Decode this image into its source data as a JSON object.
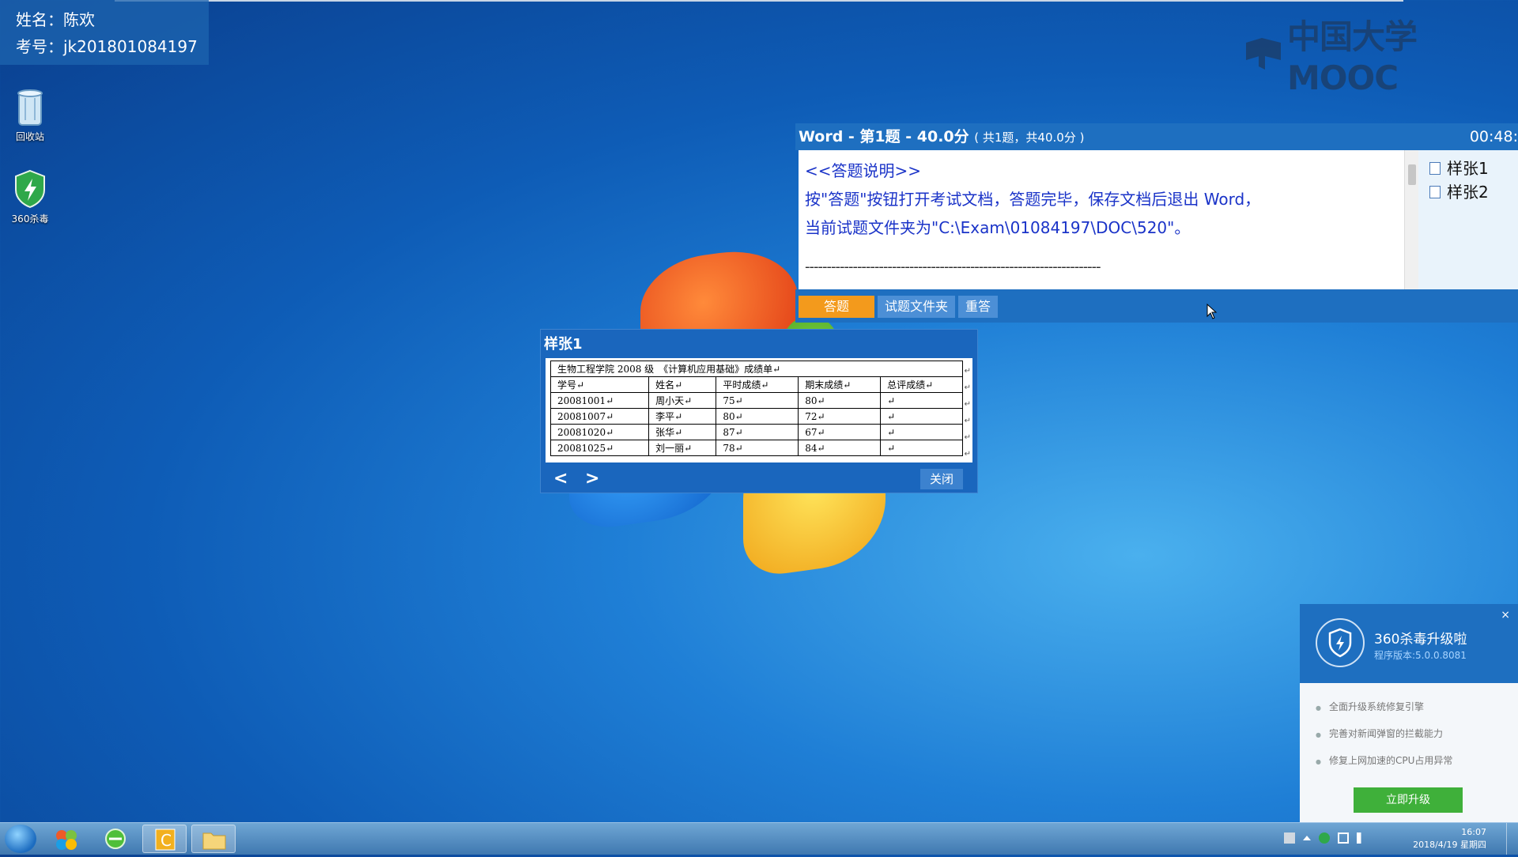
{
  "examinee": {
    "name_line": "姓名：陈欢",
    "id_line": "考号：jk201801084197"
  },
  "logo": {
    "text": "中国大学MOOC"
  },
  "desktop": {
    "icons": [
      {
        "label": "回收站",
        "icon": "recycle-bin-icon"
      },
      {
        "label": "360杀毒",
        "icon": "shield-icon"
      }
    ]
  },
  "exam": {
    "title_main": "Word - 第1题 - 40.0分",
    "title_sub": "( 共1题，共40.0分 )",
    "timer": "00:48:",
    "instructions": {
      "heading": "<<答题说明>>",
      "line1": "按\"答题\"按钮打开考试文档，答题完毕，保存文档后退出 Word，",
      "line2": "当前试题文件夹为\"C:\\Exam\\01084197\\DOC\\520\"。",
      "divider": "--------------------------------------------------------------------"
    },
    "samples": [
      "样张1",
      "样张2"
    ],
    "buttons": {
      "answer": "答题",
      "folder": "试题文件夹",
      "redo": "重答"
    }
  },
  "sample_window": {
    "title": "样张1",
    "table_title": "生物工程学院 2008 级　《计算机应用基础》成绩单↵",
    "headers": [
      "学号↵",
      "姓名↵",
      "平时成绩↵",
      "期末成绩↵",
      "总评成绩↵"
    ],
    "rows": [
      [
        "20081001↵",
        "周小天↵",
        "75↵",
        "80↵",
        "↵"
      ],
      [
        "20081007↵",
        "李平↵",
        "80↵",
        "72↵",
        "↵"
      ],
      [
        "20081020↵",
        "张华↵",
        "87↵",
        "67↵",
        "↵"
      ],
      [
        "20081025↵",
        "刘一丽↵",
        "78↵",
        "84↵",
        "↵"
      ]
    ],
    "nav_prev": "<",
    "nav_next": ">",
    "close_label": "关闭"
  },
  "popup_360": {
    "title": "360杀毒升级啦",
    "version": "程序版本:5.0.0.8081",
    "close": "×",
    "features": [
      "全面升级系统修复引擎",
      "完善对新闻弹窗的拦截能力",
      "修复上网加速的CPU占用异常"
    ],
    "upgrade_label": "立即升级"
  },
  "taskbar": {
    "clock_time": "16:07",
    "clock_date": "2018/4/19 星期四"
  },
  "colors": {
    "accent_blue": "#1e6fc0",
    "answer_orange": "#f39a1c",
    "instruction_text": "#1a33c8",
    "upgrade_green": "#3fb03a"
  }
}
